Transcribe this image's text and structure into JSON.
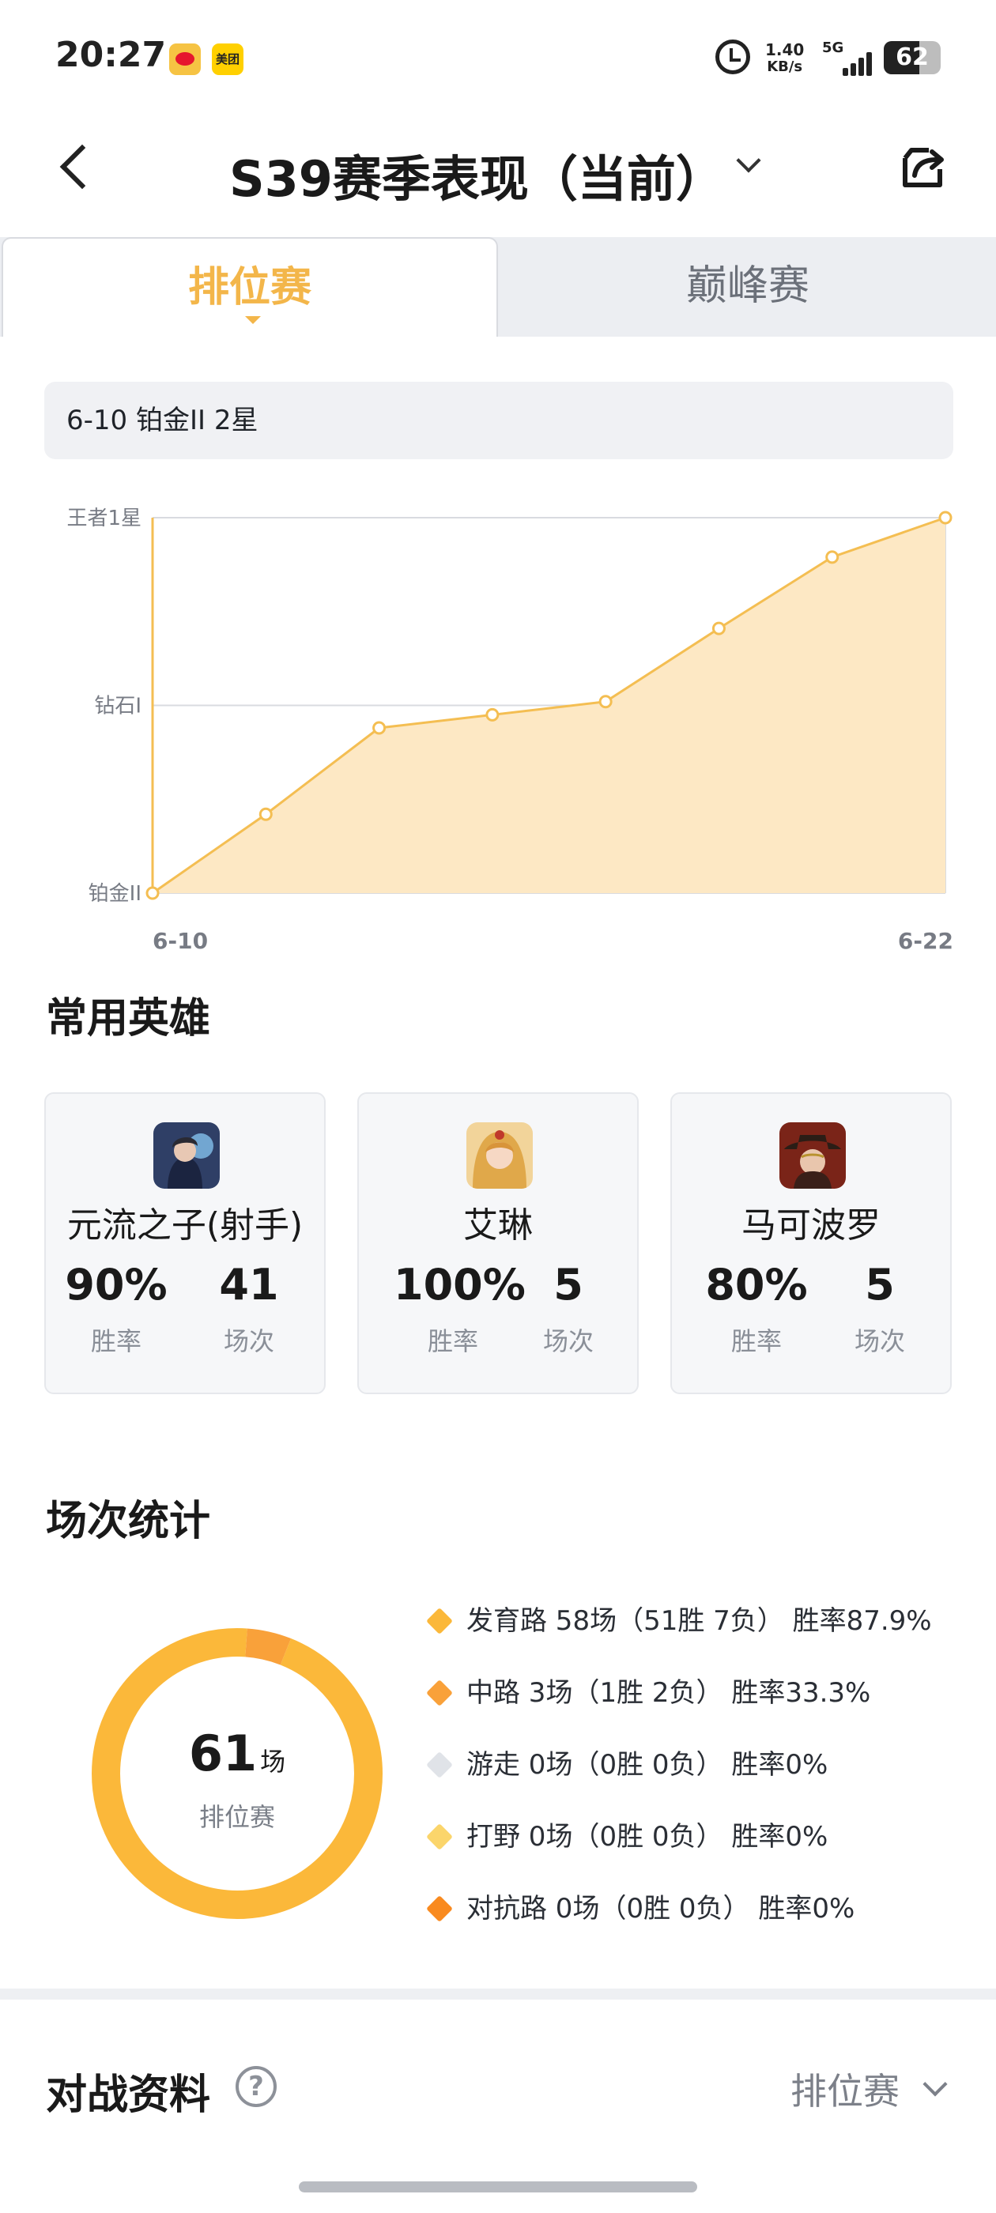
{
  "status_bar": {
    "time": "20:27",
    "app_icons": [
      "weibo-icon",
      "meituan-icon"
    ],
    "meituan_label": "美团",
    "net_speed_value": "1.40",
    "net_speed_unit": "KB/s",
    "network": "5G",
    "battery": "62",
    "battery_level": 0.62
  },
  "header": {
    "title": "S39赛季表现（当前）",
    "back_icon": "chevron-left-icon",
    "dropdown_icon": "chevron-down-icon",
    "share_icon": "share-icon"
  },
  "tabs": [
    {
      "label": "排位赛",
      "active": true
    },
    {
      "label": "巅峰赛",
      "active": false
    }
  ],
  "rank_summary": "6-10 铂金II 2星",
  "chart_data": {
    "type": "area",
    "y_tick_labels": [
      "铂金II",
      "钻石I",
      "王者1星"
    ],
    "x_tick_labels": [
      "6-10",
      "6-22"
    ],
    "values": [
      0,
      0.21,
      0.44,
      0.475,
      0.51,
      0.705,
      0.895,
      1.0
    ],
    "ylim": [
      0,
      1
    ],
    "grid": true,
    "colors": {
      "line": "#f4be52",
      "fill": "#fde8c4",
      "grid": "#d9dbe0"
    }
  },
  "heroes_section": {
    "title": "常用英雄",
    "heroes": [
      {
        "name": "元流之子(射手)",
        "win_rate": "90%",
        "win_rate_label": "胜率",
        "games": "41",
        "games_label": "场次"
      },
      {
        "name": "艾琳",
        "win_rate": "100%",
        "win_rate_label": "胜率",
        "games": "5",
        "games_label": "场次"
      },
      {
        "name": "马可波罗",
        "win_rate": "80%",
        "win_rate_label": "胜率",
        "games": "5",
        "games_label": "场次"
      }
    ]
  },
  "stats_section": {
    "title": "场次统计",
    "total": "61",
    "total_unit": "场",
    "total_label": "排位赛",
    "lanes": [
      {
        "text": "发育路 58场（51胜 7负） 胜率87.9%",
        "games": 58,
        "color": "#fbb83a"
      },
      {
        "text": "中路 3场（1胜 2负） 胜率33.3%",
        "games": 3,
        "color": "#f9a13a"
      },
      {
        "text": "游走 0场（0胜 0负） 胜率0%",
        "games": 0,
        "color": "#e0e3e8"
      },
      {
        "text": "打野 0场（0胜 0负） 胜率0%",
        "games": 0,
        "color": "#fbd56b"
      },
      {
        "text": "对抗路 0场（0胜 0负） 胜率0%",
        "games": 0,
        "color": "#f98a1f"
      }
    ]
  },
  "battle_section": {
    "title": "对战资料",
    "help_icon": "question-circle-icon",
    "mode": "排位赛",
    "mode_icon": "chevron-down-icon"
  }
}
